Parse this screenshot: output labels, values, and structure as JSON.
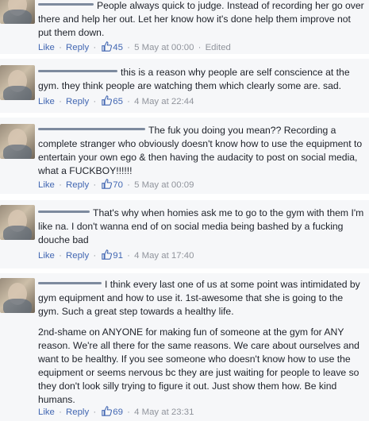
{
  "comments": [
    {
      "paragraphs": [
        "People always quick to judge. Instead of recording her go over there and help her out. Let her know how it's done help them improve not put them down."
      ],
      "actions": {
        "like": "Like",
        "reply": "Reply"
      },
      "reactions": "45",
      "timestamp": "5 May at 00:00",
      "edited": "Edited"
    },
    {
      "paragraphs": [
        "this is a reason why people are self conscience at the gym. they think people are watching them which clearly some are. sad."
      ],
      "actions": {
        "like": "Like",
        "reply": "Reply"
      },
      "reactions": "65",
      "timestamp": "4 May at 22:44"
    },
    {
      "paragraphs": [
        "The fuk you doing you mean?? Recording a complete stranger who obviously doesn't know how to use the equipment to entertain your own ego & then having the audacity to post on social media, what a FUCKBOY!!!!!!"
      ],
      "actions": {
        "like": "Like",
        "reply": "Reply"
      },
      "reactions": "70",
      "timestamp": "5 May at 00:09"
    },
    {
      "paragraphs": [
        "That's why when homies ask me to go to the gym with them I'm like na. I don't wanna end of on social media being bashed by a fucking douche bad"
      ],
      "actions": {
        "like": "Like",
        "reply": "Reply"
      },
      "reactions": "91",
      "timestamp": "4 May at 17:40"
    },
    {
      "paragraphs": [
        "I think every last one of us at some point was intimidated by gym equipment and how to use it. 1st-awesome that she is going to the gym. Such a great step towards a healthy life.",
        "2nd-shame on ANYONE for making fun of someone at the gym for ANY reason. We're all there for the same reasons. We care about ourselves and want to be healthy. If you see someone who doesn't know how to use the equipment or seems nervous bc they are just waiting for people to leave so they don't look silly trying to figure it out. Just show them how. Be kind humans."
      ],
      "actions": {
        "like": "Like",
        "reply": "Reply"
      },
      "reactions": "69",
      "timestamp": "4 May at 23:31"
    }
  ],
  "icons": {
    "avatar": "blurred-profile-photo",
    "name": "redacted-name",
    "reaction": "thumbs-up-icon"
  },
  "colors": {
    "link": "#4267b2",
    "meta": "#90949c",
    "text": "#1d2129",
    "background": "#f6f7f9",
    "redaction": "#7d8a9e"
  }
}
